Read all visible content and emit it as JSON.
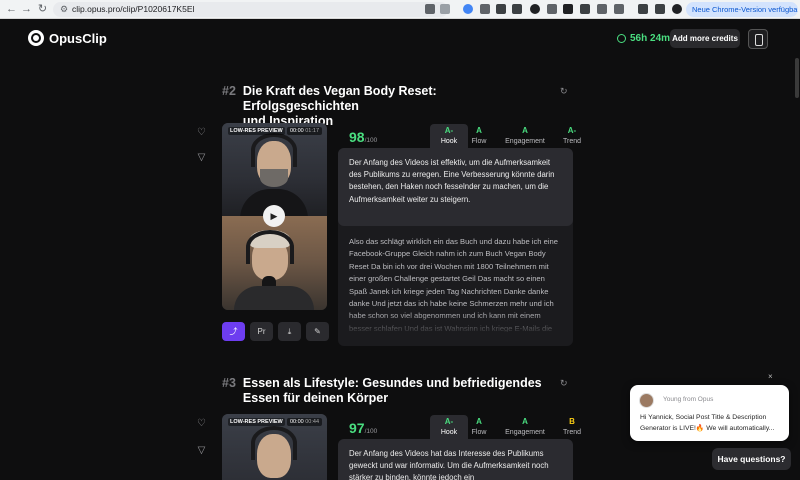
{
  "browser": {
    "url": "clip.opus.pro/clip/P1020617K5El",
    "update_label": "Neue Chrome-Version verfügbar"
  },
  "header": {
    "brand": "OpusClip",
    "time_left": "56h 24m",
    "credits_button": "Add more credits"
  },
  "clips": [
    {
      "number": "#2",
      "title_line1": "Die Kraft des Vegan Body Reset: Erfolgsgeschichten",
      "title_line2": "und Inspiration",
      "preview_badge": "LOW-RES PREVIEW",
      "time_current": "00:00",
      "time_total": "01:17",
      "score": "98",
      "score_max": "/100",
      "grades": [
        {
          "grade": "A-",
          "label": "Hook"
        },
        {
          "grade": "A",
          "label": "Flow"
        },
        {
          "grade": "A",
          "label": "Engagement"
        },
        {
          "grade": "A-",
          "label": "Trend"
        }
      ],
      "summary": "Der Anfang des Videos ist effektiv, um die Aufmerksamkeit des Publikums zu erregen. Eine Verbesserung könnte darin bestehen, den Haken noch fesselnder zu machen, um die Aufmerksamkeit weiter zu steigern.",
      "transcript": "Also das schlägt wirklich ein das Buch und dazu habe ich eine Facebook-Gruppe Gleich nahm ich zum Buch Vegan Body Reset Da bin ich vor drei Wochen mit 1800 Teilnehmern mit einer großen Challenge gestartet Geil Das macht so einen Spaß Janek ich kriege jeden Tag Nachrichten Danke danke danke Und jetzt das ich habe keine Schmerzen mehr und ich habe schon so viel abgenommen und ich kann mit einem besser schlafen Und das ist Wahnsinn ich kriege E-Mails die Leute die"
    },
    {
      "number": "#3",
      "title_line1": "Essen als Lifestyle: Gesundes und befriedigendes",
      "title_line2": "Essen für deinen Körper",
      "preview_badge": "LOW-RES PREVIEW",
      "time_current": "00:00",
      "time_total": "00:44",
      "score": "97",
      "score_max": "/100",
      "grades": [
        {
          "grade": "A-",
          "label": "Hook"
        },
        {
          "grade": "A",
          "label": "Flow"
        },
        {
          "grade": "A",
          "label": "Engagement"
        },
        {
          "grade": "B",
          "label": "Trend"
        }
      ],
      "summary": "Der Anfang des Videos hat das Interesse des Publikums geweckt und war informativ. Um die Aufmerksamkeit noch stärker zu binden, könnte jedoch ein"
    }
  ],
  "chat": {
    "from": "Young from Opus",
    "message": "Hi Yannick, Social Post Title & Description Generator is LIVE!🔥 We will automatically...",
    "close": "×",
    "have_questions": "Have questions?"
  },
  "icons": [
    "back-icon",
    "forward-icon",
    "reload-icon",
    "heart-icon",
    "thumbs-down-icon",
    "share-icon",
    "premiere-icon",
    "download-icon",
    "edit-icon",
    "refresh-icon",
    "clock-icon"
  ],
  "colors": {
    "accent": "#6d3df0",
    "score_green": "#4ade80",
    "grade_b": "#facc15"
  }
}
